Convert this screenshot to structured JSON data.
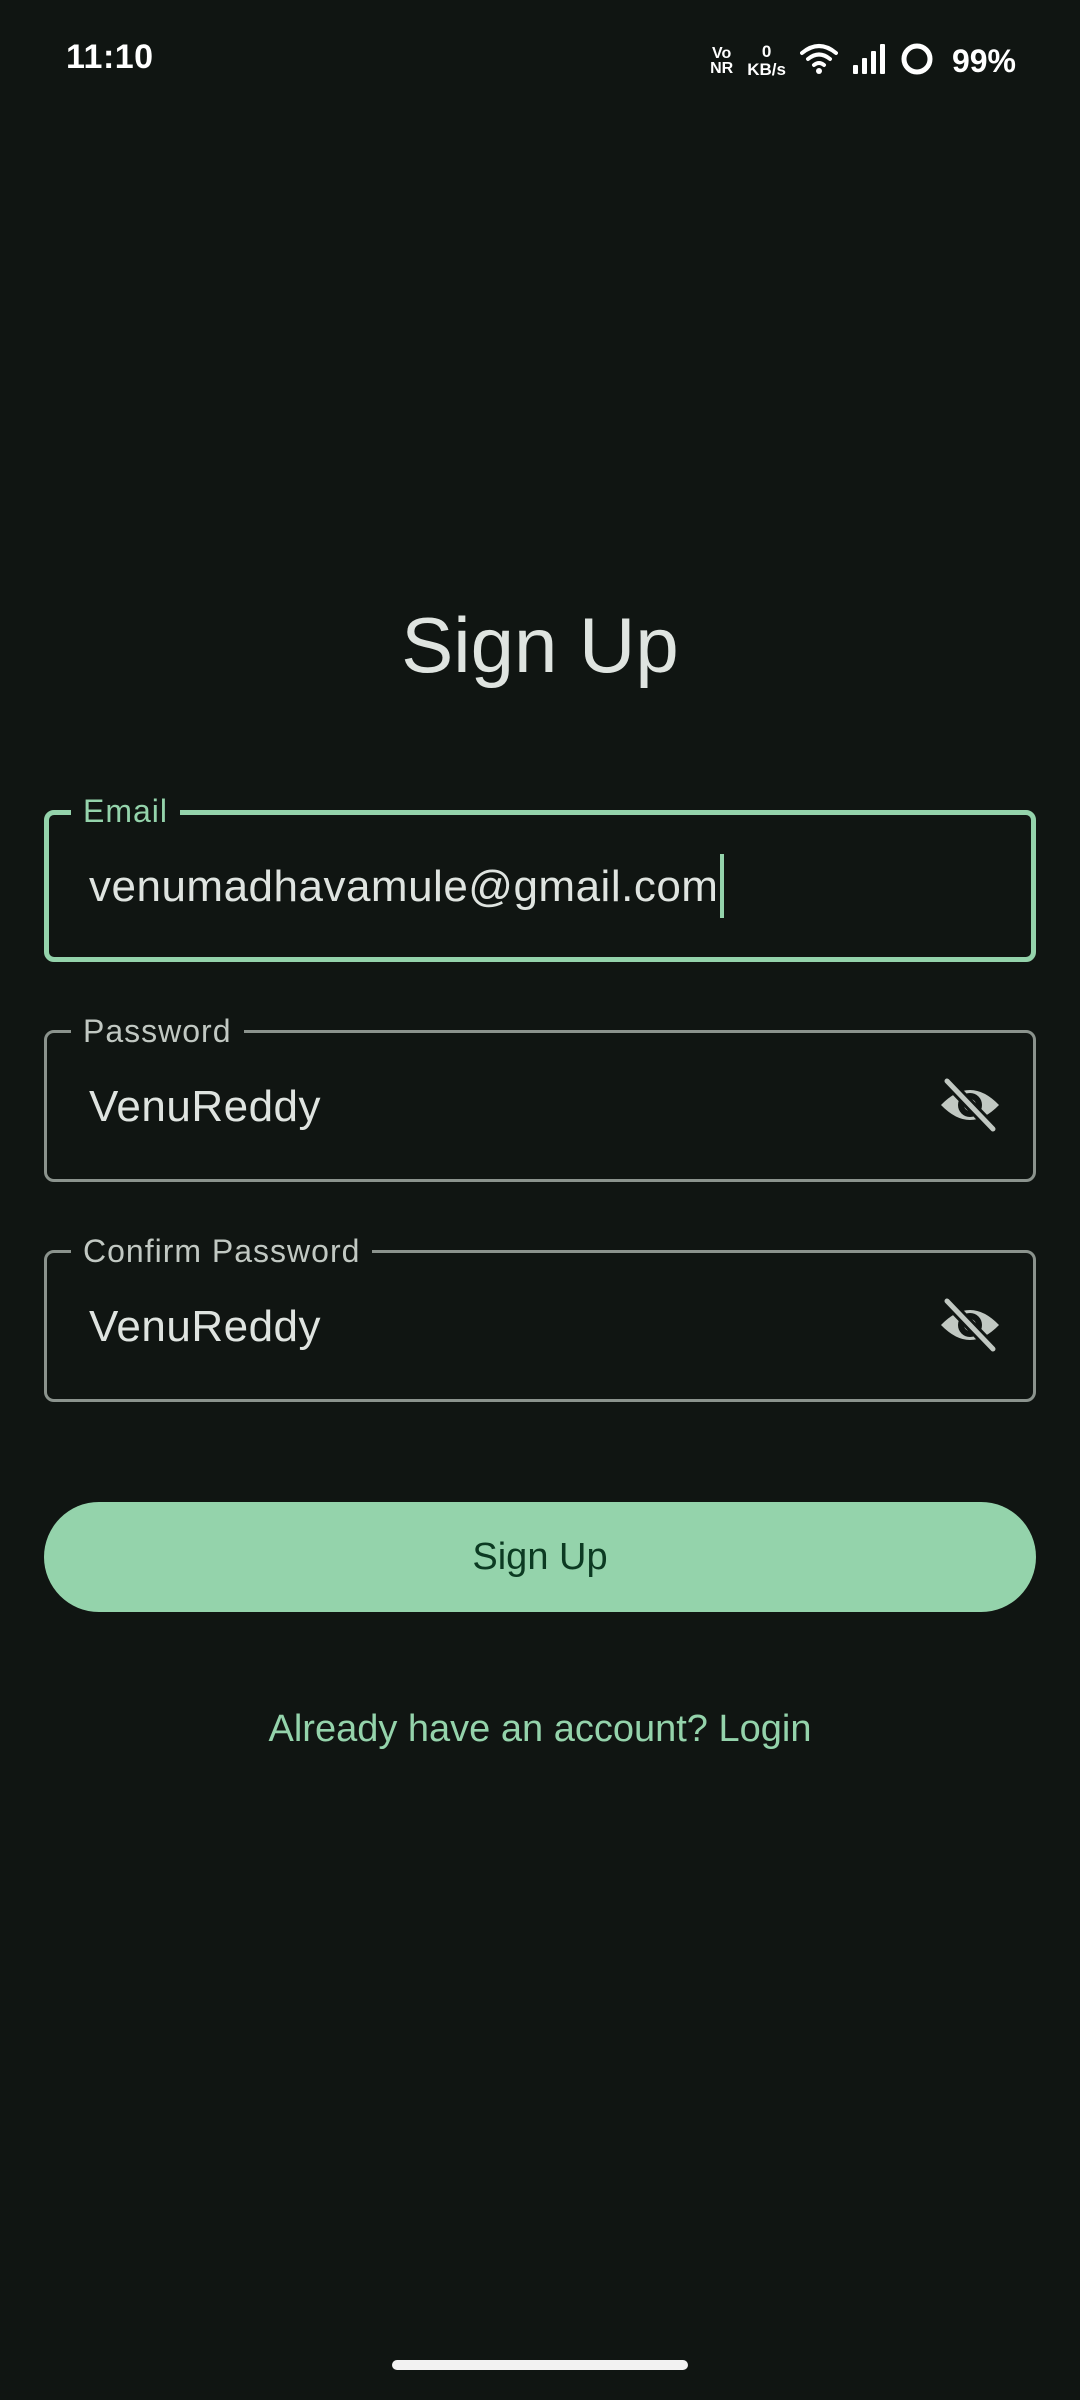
{
  "status_bar": {
    "time": "11:10",
    "vonr_top": "Vo",
    "vonr_bottom": "NR",
    "speed_value": "0",
    "speed_unit": "KB/s",
    "battery": "99%"
  },
  "title": "Sign Up",
  "form": {
    "email": {
      "label": "Email",
      "value": "venumadhavamule@gmail.com",
      "focused": true
    },
    "password": {
      "label": "Password",
      "value": "VenuReddy",
      "toggle_icon": "visibility-off-icon"
    },
    "confirm_password": {
      "label": "Confirm Password",
      "value": "VenuReddy",
      "toggle_icon": "visibility-off-icon"
    }
  },
  "signup_button_label": "Sign Up",
  "login_link": "Already have an account? Login",
  "colors": {
    "background": "#101512",
    "accent": "#94d3ab",
    "button_text": "#0c3a22",
    "outline": "#8b938d",
    "text": "#dfe4e0"
  }
}
